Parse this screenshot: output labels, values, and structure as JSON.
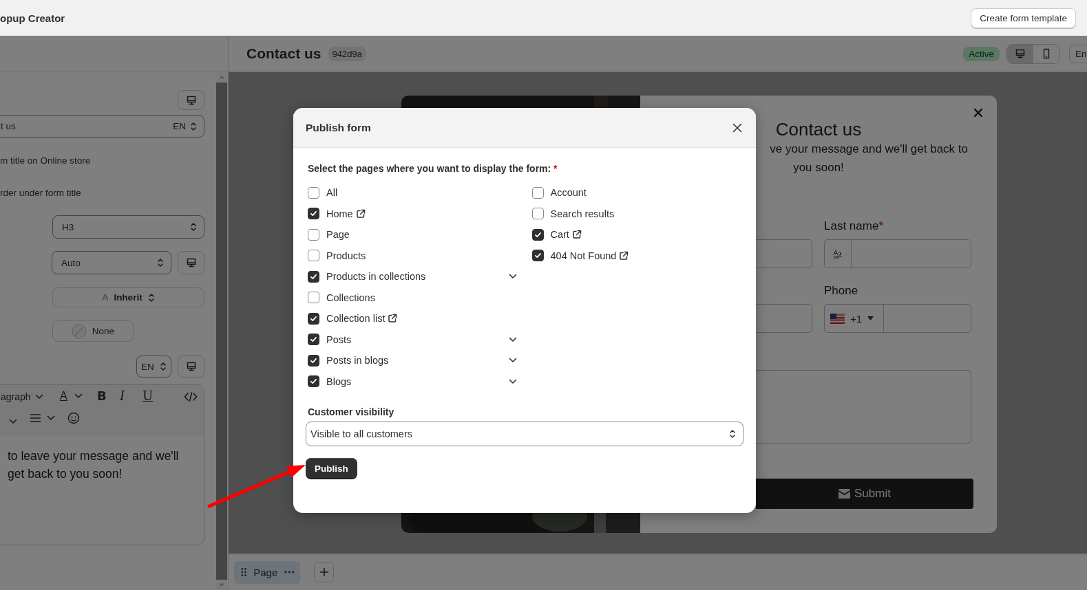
{
  "app_bar": {
    "title": "opup Creator",
    "template_button": "Create form template"
  },
  "settings": {
    "title_field": {
      "value": "t us",
      "language": "EN"
    },
    "option_texts": [
      "m title on Online store",
      "rder under form title"
    ],
    "heading_select": "H3",
    "width_select": "Auto",
    "font_button": {
      "glyph": "A",
      "label": "Inherit"
    },
    "color_button": "None",
    "language_select": "EN",
    "editor": {
      "block_type": "agraph",
      "text_color_glyph": "A",
      "format_buttons": [
        {
          "kind": "bold",
          "glyph": "B"
        },
        {
          "kind": "italic",
          "glyph": "I"
        },
        {
          "kind": "underline",
          "glyph": "U"
        }
      ],
      "lines": [
        "to leave your message and we'll",
        "get back to you soon!"
      ]
    }
  },
  "header": {
    "title": "Contact us",
    "id_badge": "942d9a",
    "status": "Active",
    "devices": [
      {
        "kind": "desktop",
        "selected": true
      },
      {
        "kind": "mobile",
        "selected": false
      }
    ],
    "language_button": "En"
  },
  "preview": {
    "title": "Contact us",
    "subtitle_lines": [
      "ve your message and we'll get back to",
      "you soon!"
    ],
    "last_name": {
      "label": "Last name",
      "required_mark": "*"
    },
    "phone": {
      "label": "Phone",
      "country_code": "+1"
    },
    "submit": "Submit"
  },
  "modal": {
    "title": "Publish form",
    "pages_label": "Select the pages where you want to display the form:",
    "required_mark": "*",
    "page_columns": [
      [
        {
          "label": "All",
          "checked": false,
          "external_link": false,
          "has_submenu": false
        },
        {
          "label": "Home",
          "checked": true,
          "external_link": true,
          "has_submenu": false
        },
        {
          "label": "Page",
          "checked": false,
          "external_link": false,
          "has_submenu": false
        },
        {
          "label": "Products",
          "checked": false,
          "external_link": false,
          "has_submenu": false
        },
        {
          "label": "Products in collections",
          "checked": true,
          "external_link": false,
          "has_submenu": true
        },
        {
          "label": "Collections",
          "checked": false,
          "external_link": false,
          "has_submenu": false
        },
        {
          "label": "Collection list",
          "checked": true,
          "external_link": true,
          "has_submenu": false
        },
        {
          "label": "Posts",
          "checked": true,
          "external_link": false,
          "has_submenu": true
        },
        {
          "label": "Posts in blogs",
          "checked": true,
          "external_link": false,
          "has_submenu": true
        },
        {
          "label": "Blogs",
          "checked": true,
          "external_link": false,
          "has_submenu": true
        }
      ],
      [
        {
          "label": "Account",
          "checked": false,
          "external_link": false,
          "has_submenu": false
        },
        {
          "label": "Search results",
          "checked": false,
          "external_link": false,
          "has_submenu": false
        },
        {
          "label": "Cart",
          "checked": true,
          "external_link": true,
          "has_submenu": false
        },
        {
          "label": "404 Not Found",
          "checked": true,
          "external_link": true,
          "has_submenu": false
        }
      ]
    ],
    "visibility_label": "Customer visibility",
    "visibility_value": "Visible to all customers",
    "publish_button": "Publish"
  },
  "pages_bar": {
    "tabs": [
      {
        "label": "Page",
        "selected": true
      }
    ]
  }
}
